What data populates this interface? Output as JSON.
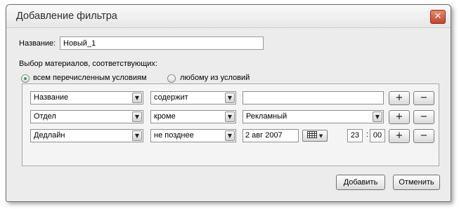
{
  "dialog": {
    "title": "Добавление фильтра",
    "close_icon": "close-icon"
  },
  "name": {
    "label": "Название:",
    "value": "Новый_1"
  },
  "selection": {
    "label": "Выбор материалов, соответствующих:",
    "options": [
      {
        "label": "всем перечисленным условиям",
        "selected": true
      },
      {
        "label": "любому из условий",
        "selected": false
      }
    ]
  },
  "conditions": [
    {
      "field": "Название",
      "operator": "содержит",
      "value": ""
    },
    {
      "field": "Отдел",
      "operator": "кроме",
      "value": "Рекламный"
    },
    {
      "field": "Дедлайн",
      "operator": "не позднее",
      "value": "2 авг 2007",
      "hour": "23",
      "minute": "00",
      "time_separator": ":"
    }
  ],
  "row_buttons": {
    "add": "+",
    "remove": "−"
  },
  "dropdown_arrow": "▼",
  "calendar_icon": "calendar-icon",
  "footer": {
    "add_label": "Добавить",
    "cancel_label": "Отменить"
  },
  "colors": {
    "close": "#c4452a",
    "radio_selected": "#2ea44a"
  }
}
